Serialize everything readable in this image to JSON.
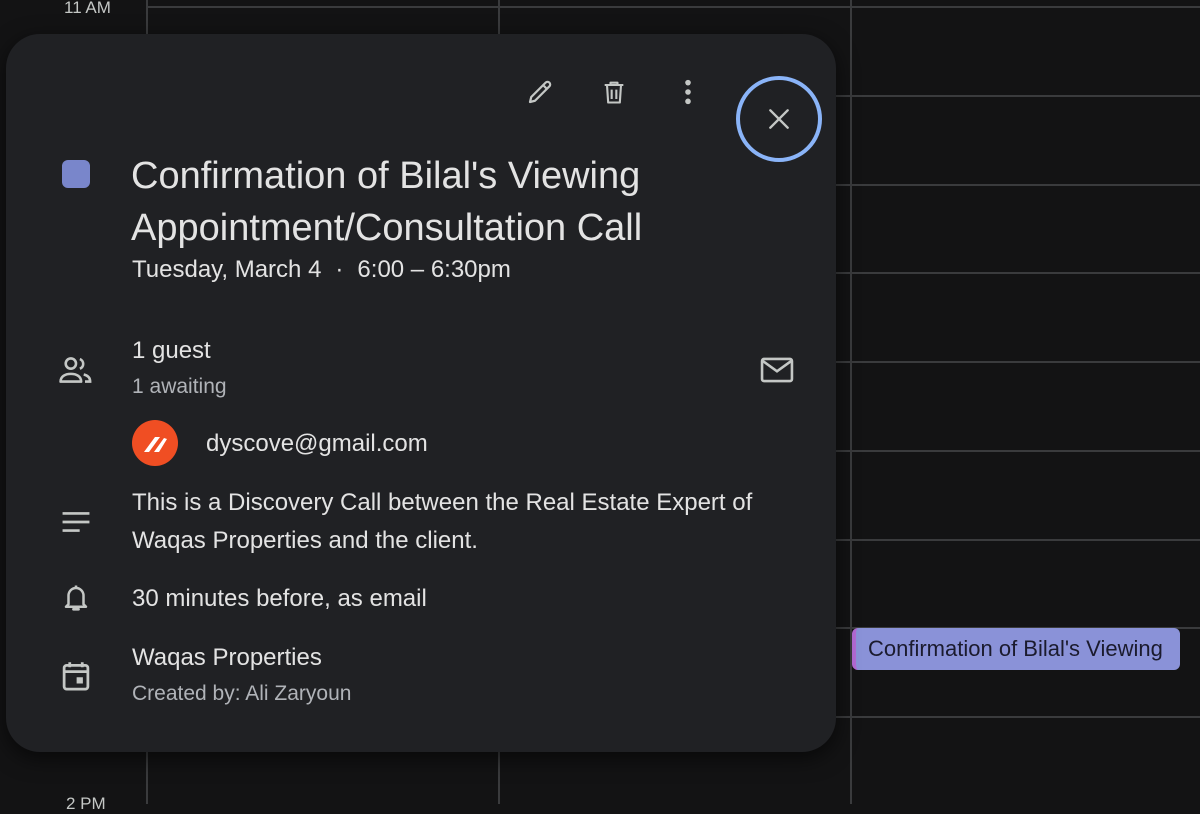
{
  "calendar": {
    "time_top": "11 AM",
    "time_bottom": "2 PM",
    "event_chip_label": "Confirmation of Bilal's Viewing"
  },
  "toolbar": {
    "edit_icon": "pencil-icon",
    "delete_icon": "trash-icon",
    "more_icon": "more-vert-icon",
    "close_icon": "close-icon"
  },
  "event": {
    "color": "#7986cb",
    "title": "Confirmation of Bilal's Viewing Appointment/Consultation Call",
    "date": "Tuesday, March 4",
    "separator": "·",
    "time": "6:00 – 6:30pm"
  },
  "guests": {
    "count_label": "1 guest",
    "status_label": "1 awaiting",
    "list": [
      {
        "email": "dyscove@gmail.com"
      }
    ]
  },
  "description": "This is a Discovery Call between the Real Estate Expert of Waqas Properties and the client.",
  "reminder": "30 minutes before, as email",
  "calendar_info": {
    "name": "Waqas Properties",
    "created_by": "Created by: Ali Zaryoun"
  },
  "colors": {
    "background": "#131314",
    "card": "#202124",
    "accent_ring": "#8ab4f8",
    "avatar": "#f04e23",
    "event_chip": "#8a92d8"
  }
}
